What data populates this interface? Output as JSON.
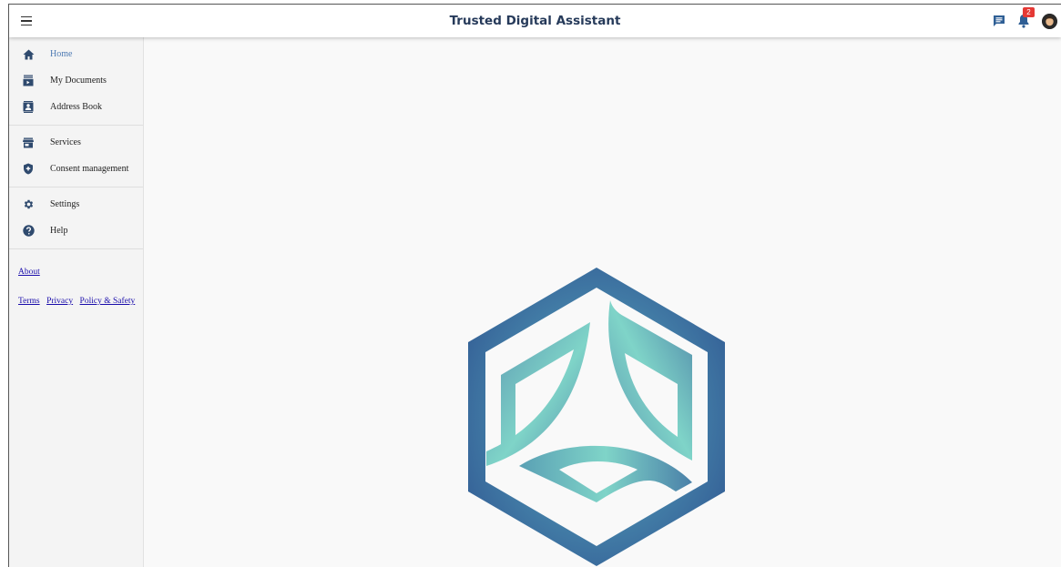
{
  "app": {
    "title": "Trusted Digital Assistant"
  },
  "header": {
    "notification_count": "2",
    "icons": {
      "menu": "hamburger-menu-icon",
      "chat": "chat-icon",
      "notifications": "bell-icon",
      "avatar": "user-avatar"
    }
  },
  "sidebar": {
    "groups": [
      [
        {
          "label": "Home",
          "icon": "home-icon",
          "active": true
        },
        {
          "label": "My Documents",
          "icon": "documents-icon"
        },
        {
          "label": "Address Book",
          "icon": "contacts-icon"
        }
      ],
      [
        {
          "label": "Services",
          "icon": "store-icon"
        },
        {
          "label": "Consent management",
          "icon": "shield-icon"
        }
      ],
      [
        {
          "label": "Settings",
          "icon": "gear-icon"
        },
        {
          "label": "Help",
          "icon": "help-icon"
        }
      ]
    ],
    "links": {
      "about": "About",
      "terms": "Terms",
      "privacy": "Privacy",
      "policy": "Policy & Safety"
    }
  },
  "colors": {
    "accent": "#4d7ab3",
    "title": "#263a5a",
    "icon": "#2f4a6e",
    "badge": "#e53935",
    "logo_outer": "#3a6a9e",
    "logo_inner": "#7fd4c8"
  }
}
